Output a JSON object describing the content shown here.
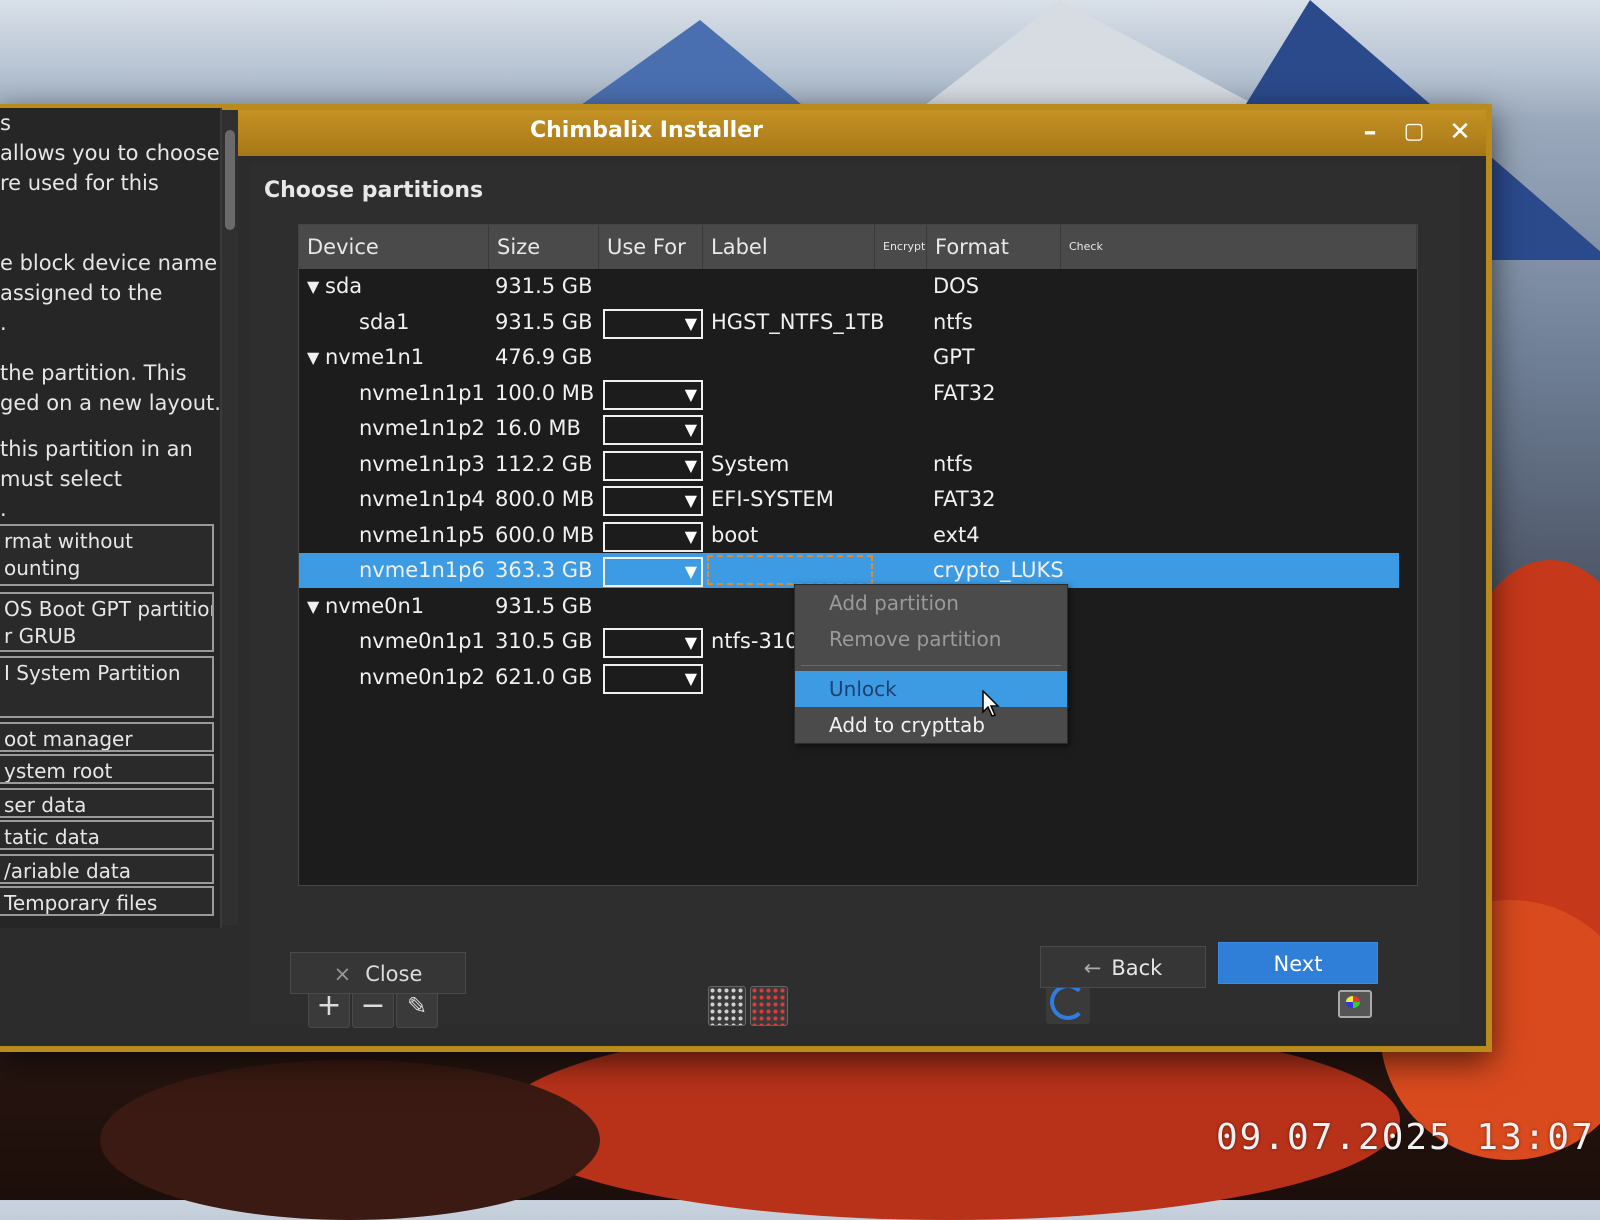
{
  "window": {
    "title": "Chimbalix Installer"
  },
  "section_title": "Choose partitions",
  "sidebar": {
    "texts": [
      "s",
      "allows you to choose",
      "re used for this",
      "e block device name",
      "assigned to the",
      ".",
      "the partition. This",
      "ged on a new layout.",
      "this partition in an",
      "must select",
      "."
    ],
    "boxes": [
      "rmat without\nounting",
      "OS Boot GPT partition\nr GRUB",
      "I System Partition",
      "oot manager",
      "ystem root",
      "ser data",
      "tatic data",
      "/ariable data",
      "Temporary files"
    ]
  },
  "table": {
    "columns": [
      "Device",
      "Size",
      "Use For",
      "Label",
      "Encrypt",
      "Format",
      "Check"
    ],
    "rows": [
      {
        "device": "sda",
        "size": "931.5 GB",
        "label": "",
        "format": "DOS",
        "expandable": true
      },
      {
        "device": "sda1",
        "size": "931.5 GB",
        "label": "HGST_NTFS_1TB",
        "format": "ntfs",
        "combo": true
      },
      {
        "device": "nvme1n1",
        "size": "476.9 GB",
        "label": "",
        "format": "GPT",
        "expandable": true
      },
      {
        "device": "nvme1n1p1",
        "size": "100.0 MB",
        "label": "",
        "format": "FAT32",
        "combo": true
      },
      {
        "device": "nvme1n1p2",
        "size": "16.0 MB",
        "label": "",
        "format": "",
        "combo": true
      },
      {
        "device": "nvme1n1p3",
        "size": "112.2 GB",
        "label": "System",
        "format": "ntfs",
        "combo": true
      },
      {
        "device": "nvme1n1p4",
        "size": "800.0 MB",
        "label": "EFI-SYSTEM",
        "format": "FAT32",
        "combo": true
      },
      {
        "device": "nvme1n1p5",
        "size": "600.0 MB",
        "label": "boot",
        "format": "ext4",
        "combo": true
      },
      {
        "device": "nvme1n1p6",
        "size": "363.3 GB",
        "label": "",
        "format": "crypto_LUKS",
        "combo": true,
        "selected": true
      },
      {
        "device": "nvme0n1",
        "size": "931.5 GB",
        "label": "",
        "format": "",
        "expandable": true
      },
      {
        "device": "nvme0n1p1",
        "size": "310.5 GB",
        "label": "ntfs-310g",
        "format": "",
        "combo": true
      },
      {
        "device": "nvme0n1p2",
        "size": "621.0 GB",
        "label": "",
        "format": "",
        "combo": true
      }
    ]
  },
  "context_menu": {
    "items": [
      {
        "label": "Add partition",
        "state": "disabled"
      },
      {
        "label": "Remove partition",
        "state": "disabled"
      },
      {
        "label": "Unlock",
        "state": "active"
      },
      {
        "label": "Add to crypttab",
        "state": "enabled"
      }
    ]
  },
  "toolbar": {
    "add": "+",
    "remove": "−",
    "edit": "✎"
  },
  "buttons": {
    "close": "Close",
    "close_icon": "×",
    "back": "Back",
    "back_icon": "←",
    "next": "Next"
  },
  "photo_timestamp": "09.07.2025 13:07",
  "colors": {
    "accent": "#3d9be3",
    "titlebar": "#b98a1c",
    "next_button": "#2f7fd8"
  }
}
